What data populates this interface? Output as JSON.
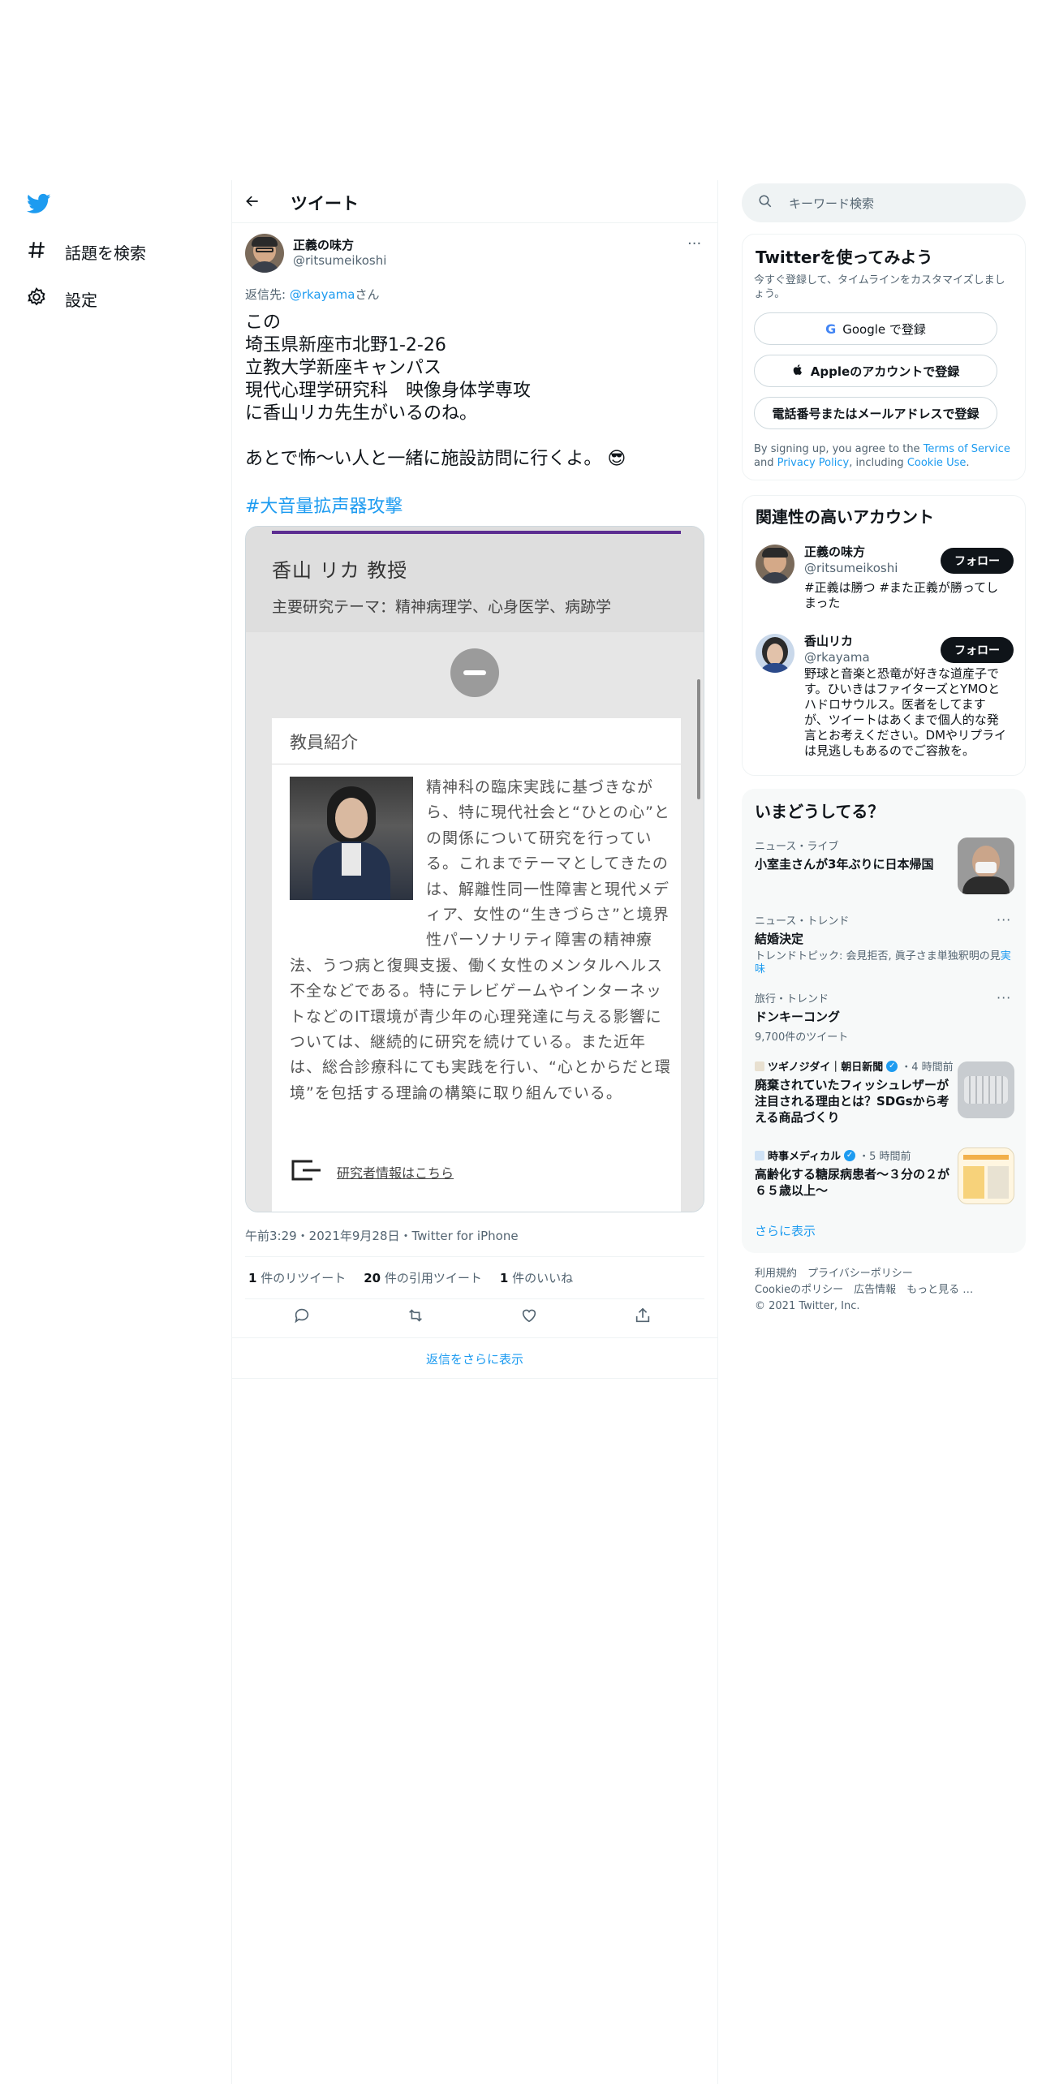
{
  "nav": {
    "items": [
      {
        "label": "話題を検索",
        "icon": "hashtag-icon"
      },
      {
        "label": "設定",
        "icon": "gear-icon"
      }
    ]
  },
  "header": {
    "title": "ツイート"
  },
  "tweet": {
    "author_name": "正義の味方",
    "author_handle": "@ritsumeikoshi",
    "reply_prefix": "返信先: ",
    "reply_to": "@rkayama",
    "reply_suffix": "さん",
    "body": "この\n埼玉県新座市北野1-2-26\n立教大学新座キャンパス\n現代心理学研究科　映像身体学専攻\nに香山リカ先生がいるのね。\n\nあとで怖〜い人と一緒に施設訪問に行くよ。",
    "emoji": "😎",
    "hashtag": "#大音量拡声器攻撃",
    "meta": "午前3:29・2021年9月28日・Twitter for iPhone",
    "stats": {
      "retweets_count": "1",
      "retweets_label": " 件のリツイート",
      "quotes_count": "20",
      "quotes_label": " 件の引用ツイート",
      "likes_count": "1",
      "likes_label": " 件のいいね"
    },
    "more_replies": "返信をさらに表示"
  },
  "card": {
    "name": "香山 リカ 教授",
    "theme": "主要研究テーマ：精神病理学、心身医学、病跡学",
    "panel_title": "教員紹介",
    "bio": "精神科の臨床実践に基づきながら、特に現代社会と“ひとの心”との関係について研究を行っている。これまでテーマとしてきたのは、解離性同一性障害と現代メディア、女性の“生きづらさ”と境界性パーソナリティ障害の精神療法、うつ病と復興支援、働く女性のメンタルヘルス不全などである。特にテレビゲームやインターネットなどのIT環境が青少年の心理発達に与える影響については、継続的に研究を続けている。また近年は、総合診療科にても実践を行い、“心とからだと環境”を包括する理論の構築に取り組んでいる。",
    "research_link": "研究者情報はこちら"
  },
  "search": {
    "placeholder": "キーワード検索"
  },
  "signup": {
    "title": "Twitterを使ってみよう",
    "desc": "今すぐ登録して、タイムラインをカスタマイズしましょう。",
    "google": "Google で登録",
    "apple": "Appleのアカウントで登録",
    "phone": "電話番号またはメールアドレスで登録",
    "legal_1": "By signing up, you agree to the ",
    "tos": "Terms of Service",
    "legal_2": " and ",
    "privacy": "Privacy Policy",
    "legal_3": ", including ",
    "cookie": "Cookie Use",
    "legal_4": "."
  },
  "related": {
    "title": "関連性の高いアカウント",
    "follow_label": "フォロー",
    "accounts": [
      {
        "name": "正義の味方",
        "handle": "@ritsumeikoshi",
        "bio": "#正義は勝つ #また正義が勝ってしまった"
      },
      {
        "name": "香山リカ",
        "handle": "@rkayama",
        "bio": "野球と音楽と恐竜が好きな道産子です。ひいきはファイターズとYMOとハドロサウルス。医者をしてますが、ツイートはあくまで個人的な発言とお考えください。DMやリプライは見逃しもあるのでご容赦を。"
      }
    ]
  },
  "trends": {
    "title": "いまどうしてる？",
    "items": [
      {
        "meta": "ニュース・ライブ",
        "title": "小室圭さんが3年ぶりに日本帰国"
      },
      {
        "meta": "ニュース・トレンド",
        "title": "結婚決定",
        "sub": "トレンドトピック: 会見拒否, 眞子さま単独釈明の見",
        "sub2": "実味"
      },
      {
        "meta": "旅行・トレンド",
        "title": "ドンキーコング",
        "sub": "9,700件のツイート"
      },
      {
        "source": "ツギノジダイ｜朝日新聞",
        "time": "・4 時間前",
        "title": "廃棄されていたフィッシュレザーが注目される理由とは？SDGsから考える商品づくり"
      },
      {
        "source": "時事メディカル",
        "time": "・5 時間前",
        "title": "高齢化する糖尿病患者～３分の２が６５歳以上～"
      }
    ],
    "show_more": "さらに表示"
  },
  "footer": {
    "line1": "利用規約　プライバシーポリシー",
    "line2": "Cookieのポリシー　広告情報　もっと見る …",
    "line3": "© 2021 Twitter, Inc."
  }
}
